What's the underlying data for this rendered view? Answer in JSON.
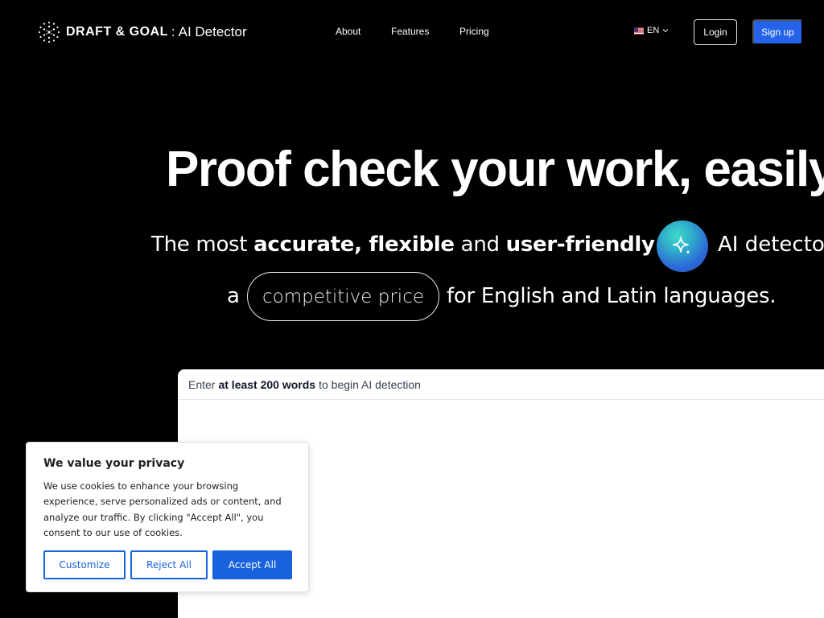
{
  "nav": {
    "brand": "DRAFT & GOAL",
    "separator": ":",
    "product": "AI Detector",
    "links": [
      {
        "label": "About"
      },
      {
        "label": "Features"
      },
      {
        "label": "Pricing"
      }
    ],
    "language": "EN",
    "login_label": "Login",
    "signup_label": "Sign up"
  },
  "hero": {
    "title": "Proof check your work, easily",
    "sub1_pre": "The most ",
    "sub1_bold1": "accurate, flexible",
    "sub1_mid": " and ",
    "sub1_bold2": "user-friendly",
    "sub1_end": "AI detector",
    "sub2_pre": "a",
    "pill": "competitive price",
    "sub2_post": "for English and Latin languages."
  },
  "editor": {
    "prompt_pre": "Enter",
    "prompt_bold": "at least 200 words",
    "prompt_post": "to begin AI detection"
  },
  "cookie": {
    "title": "We value your privacy",
    "text": "We use cookies to enhance your browsing experience, serve personalized ads or content, and analyze our traffic. By clicking \"Accept All\", you consent to our use of cookies.",
    "customize_label": "Customize",
    "reject_label": "Reject All",
    "accept_label": "Accept All"
  },
  "colors": {
    "background": "#000000",
    "primary": "#2563eb",
    "cookie_accent": "#1863dc"
  },
  "icons": {
    "logo": "dotted-circle-logo-icon",
    "flag": "us-flag-icon",
    "chevron": "chevron-down-icon",
    "sparkle": "sparkle-icon"
  }
}
